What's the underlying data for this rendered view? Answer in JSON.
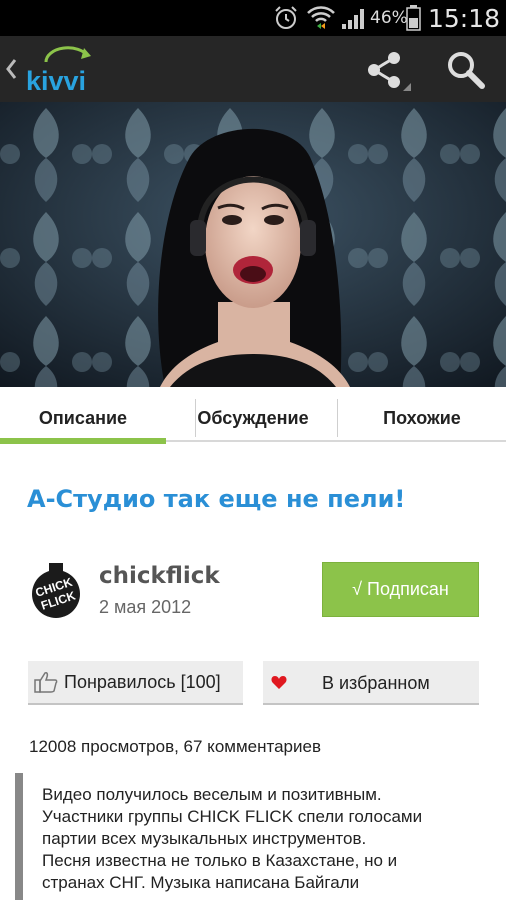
{
  "status_bar": {
    "battery_percent": "46%",
    "time": "15:18"
  },
  "app": {
    "logo_text": "kivvi"
  },
  "tabs": [
    {
      "label": "Описание",
      "active": true
    },
    {
      "label": "Обсуждение",
      "active": false
    },
    {
      "label": "Похожие",
      "active": false
    }
  ],
  "video": {
    "title": "А-Студио так еще не пели!",
    "channel": {
      "name": "chickflick",
      "date": "2 мая 2012",
      "avatar_text": "CHICK FLICK"
    },
    "subscribe_label": "√ Подписан",
    "like_label": "Понравилось [100]",
    "favorite_label": "В избранном",
    "stats": "12008 просмотров, 67 комментариев",
    "description_lines": [
      "Видео получилось веселым и позитивным.",
      "Участники группы CHICK FLICK спели голосами",
      "партии всех музыкальных инструментов.",
      "Песня известна не только в Казахстане, но и",
      "странах СНГ. Музыка написана Байгали"
    ]
  },
  "colors": {
    "accent_green": "#8cc34a",
    "title_blue": "#2a8fd6",
    "action_bar": "#262626"
  }
}
